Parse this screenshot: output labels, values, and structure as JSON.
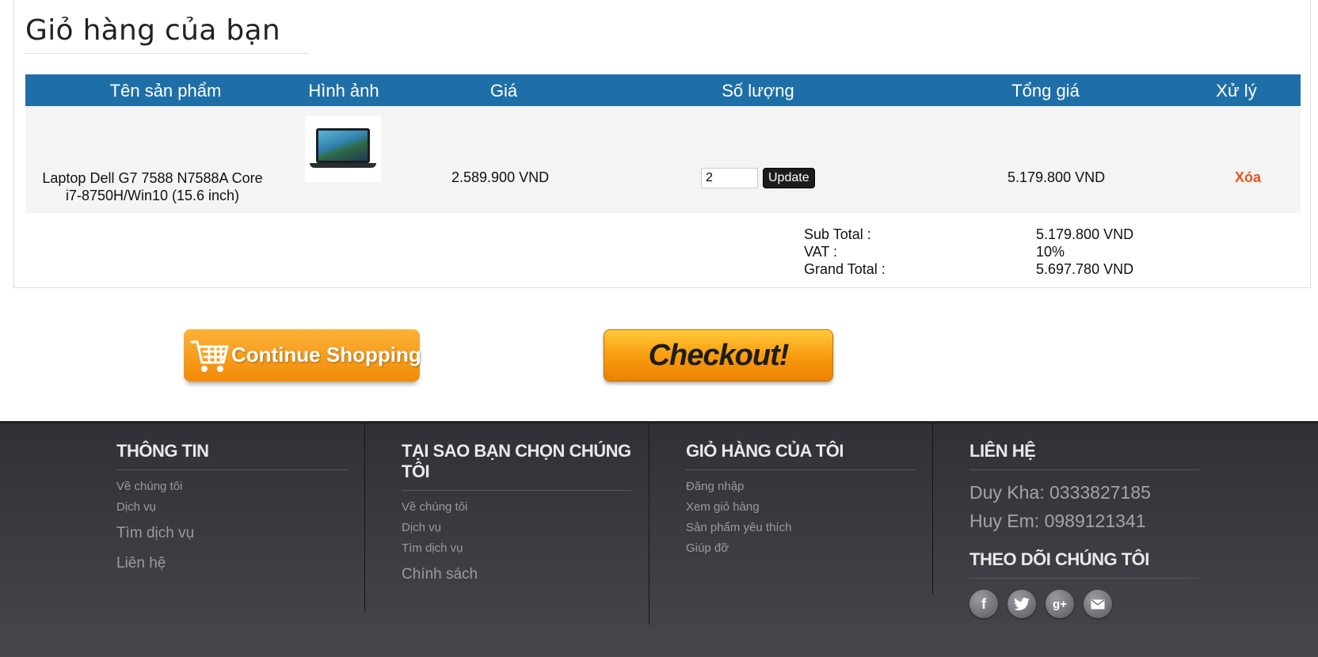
{
  "cart": {
    "title": "Giỏ hàng của bạn",
    "columns": [
      "Tên sản phẩm",
      "Hình ảnh",
      "Giá",
      "Số lượng",
      "Tổng giá",
      "Xử lý"
    ],
    "item": {
      "name_line1": "Laptop Dell G7 7588 N7588A Core",
      "name_line2": "i7-8750H/Win10 (15.6 inch)",
      "price": "2.589.900 VND",
      "quantity": "2",
      "update_label": "Update",
      "total": "5.179.800 VND",
      "delete_label": "Xóa"
    },
    "summary": {
      "subtotal_label": "Sub Total :",
      "vat_label": "VAT :",
      "grand_label": "Grand Total :",
      "subtotal": "5.179.800 VND",
      "vat": "10%",
      "grand": "5.697.780 VND"
    }
  },
  "actions": {
    "continue_label": "Continue Shopping",
    "checkout_label": "Checkout!"
  },
  "footer": {
    "col1": {
      "title": "THÔNG TIN",
      "links": [
        "Về chúng tôi",
        "Dịch vụ",
        "Tìm dịch vụ",
        "Liên hệ"
      ]
    },
    "col2": {
      "title_line1": "TẠI SAO BẠN CHỌN CHÚNG",
      "title_line2": "TÔI",
      "links": [
        "Về chúng tôi",
        "Dịch vụ",
        "Tìm dịch vụ",
        "Chính sách"
      ]
    },
    "col3": {
      "title": "GIỎ HÀNG CỦA TÔI",
      "links": [
        "Đăng nhập",
        "Xem giỏ hàng",
        "Sản phẩm yêu thích",
        "Giúp đỡ"
      ]
    },
    "col4": {
      "title": "LIÊN HỆ",
      "contacts": [
        "Duy Kha: 0333827185",
        "Huy Em: 0989121341"
      ],
      "follow_title": "THEO DÕI CHÚNG TÔI",
      "social": [
        "facebook-icon",
        "twitter-icon",
        "google-plus-icon",
        "mail-icon"
      ]
    }
  },
  "colors": {
    "header_blue": "#1e6fa8",
    "delete_orange": "#e8531f",
    "button_orange": "#f28a07",
    "footer_dark": "#36363b"
  }
}
